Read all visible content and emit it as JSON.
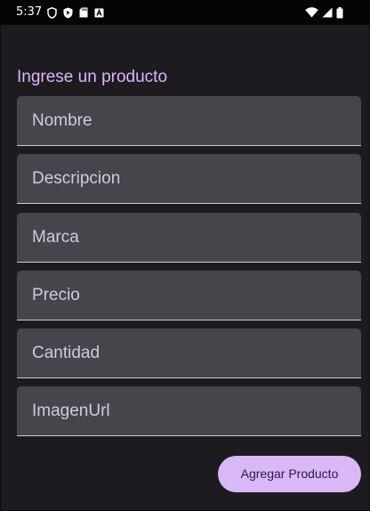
{
  "status_bar": {
    "time": "5:37",
    "left_icons": [
      "shield-icon",
      "play-protect-icon",
      "sd-card-icon",
      "font-a-icon"
    ],
    "right_icons": [
      "wifi-icon",
      "cellular-signal-icon",
      "battery-icon"
    ]
  },
  "form": {
    "title": "Ingrese un producto",
    "fields": [
      {
        "label": "Nombre"
      },
      {
        "label": "Descripcion"
      },
      {
        "label": "Marca"
      },
      {
        "label": "Precio"
      },
      {
        "label": "Cantidad"
      },
      {
        "label": "ImagenUrl"
      }
    ],
    "submit_label": "Agregar Producto"
  },
  "colors": {
    "background": "#1e1b20",
    "field_background": "#47444b",
    "accent": "#d8b8f7",
    "title": "#d9b6fb"
  }
}
